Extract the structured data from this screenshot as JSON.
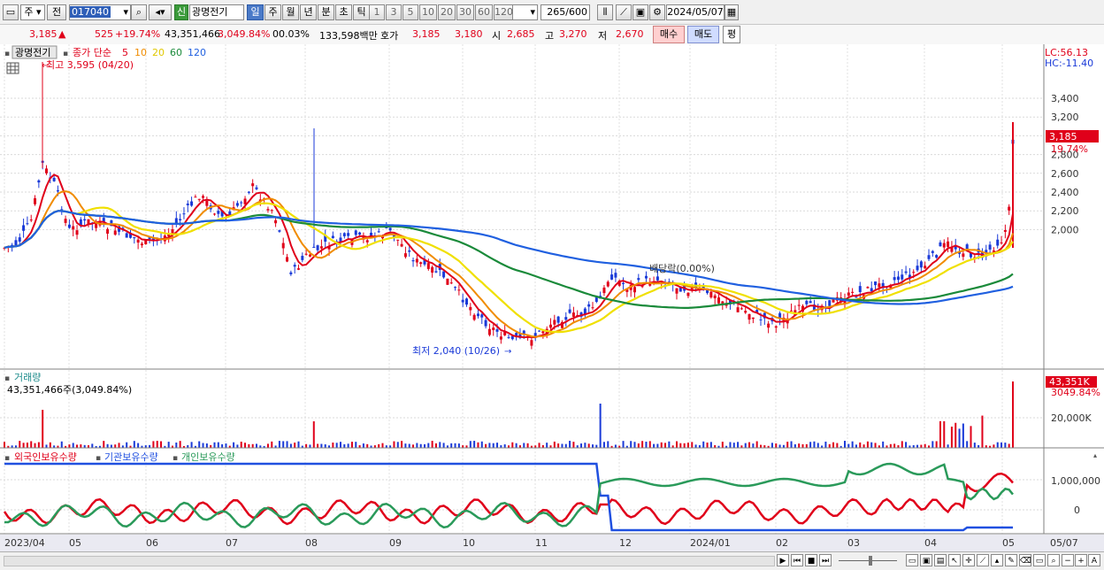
{
  "toolbar": {
    "market": "주",
    "prev": "전",
    "code": "017040",
    "badge": "신",
    "name": "광명전기",
    "periods": [
      "일",
      "주",
      "월",
      "년",
      "분",
      "초",
      "틱"
    ],
    "active_period": "일",
    "intervals": [
      "1",
      "3",
      "5",
      "10",
      "20",
      "30",
      "60",
      "120"
    ],
    "count": "265",
    "total": "/600",
    "date": "2024/05/07"
  },
  "quote": {
    "price": "3,185",
    "change": "525",
    "rate": "+19.74%",
    "volume": "43,351,466",
    "vol_rate": "3,049.84%",
    "turnover": "00.03%",
    "amount": "133,598백만",
    "ask_label": "호가",
    "ask": "3,185",
    "bid": "3,180",
    "open_label": "시",
    "open": "2,685",
    "high_label": "고",
    "high": "3,270",
    "low_label": "저",
    "low": "2,670",
    "buy": "매수",
    "sell": "매도",
    "eval": "평"
  },
  "price_panel": {
    "title": "광명전기",
    "legend_prefix": "종가 단순",
    "ma": [
      "5",
      "10",
      "20",
      "60",
      "120"
    ],
    "ma_colors": [
      "#e0001a",
      "#f08c00",
      "#f0e000",
      "#1a8a3a",
      "#2060e0"
    ],
    "high_note": "최고 3,595 (04/20)",
    "low_note": "최저 2,040 (10/26)",
    "div_note": "배당락(0.00%)",
    "lc": "LC:56.13",
    "hc": "HC:-11.40",
    "last": "3,185",
    "last_rate": "19.74%",
    "y_labels": [
      "3,400",
      "3,200",
      "3,000",
      "2,800",
      "2,600",
      "2,400",
      "2,200",
      "2,000"
    ]
  },
  "vol_panel": {
    "title": "거래량",
    "value": "43,351,466주(3,049.84%)",
    "last": "43,351K",
    "last_rate": "3049.84%",
    "y_label": "20,000K"
  },
  "holder_panel": {
    "legend": [
      "외국인보유수량",
      "기관보유수량",
      "개인보유수량"
    ],
    "colors": [
      "#e0001a",
      "#2050e0",
      "#2a9a5a"
    ],
    "y_labels": [
      "1,000,000",
      "0"
    ]
  },
  "x_labels": [
    "2023/04",
    "05",
    "06",
    "07",
    "08",
    "09",
    "10",
    "11",
    "12",
    "2024/01",
    "02",
    "03",
    "04",
    "05",
    "05/07"
  ]
}
